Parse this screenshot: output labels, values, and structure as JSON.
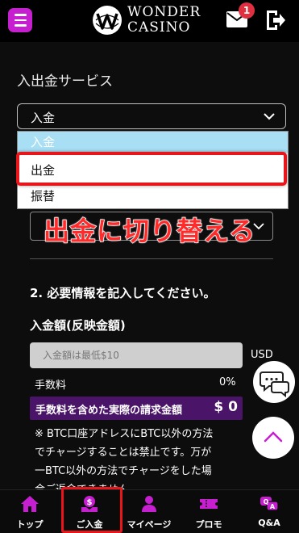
{
  "header": {
    "logo_line1": "WONDER",
    "logo_line2": "CASINO",
    "mail_badge": "1"
  },
  "page": {
    "section_title": "入出金サービス",
    "select_value": "入金"
  },
  "dropdown": {
    "options": [
      "入金",
      "出金",
      "振替"
    ],
    "highlighted_index": 1
  },
  "annotation": "出金に切り替える",
  "form": {
    "step2": "2. 必要情報を記入してください。",
    "amount_label": "入金額(反映金額)",
    "amount_placeholder": "入金額は最低$10",
    "currency": "USD",
    "fee_label": "手数料",
    "fee_value": "0%",
    "total_label": "手数料を含めた実際の請求金額",
    "total_value": "$ 0",
    "notice_lines": [
      "※ BTC口座アドレスにBTC以外の方法",
      "でチャージすることは禁止です。万が",
      "一BTC以外の方法でチャージをした場",
      "合ご返金できません"
    ]
  },
  "bottom_nav": {
    "items": [
      {
        "label": "トップ",
        "icon": "home-icon"
      },
      {
        "label": "ご入金",
        "icon": "deposit-icon"
      },
      {
        "label": "マイページ",
        "icon": "user-icon"
      },
      {
        "label": "プロモ",
        "icon": "ticket-icon"
      },
      {
        "label": "Q&A",
        "icon": "qa-icon"
      }
    ]
  },
  "colors": {
    "accent": "#c61fd0",
    "total_bar": "#4a1568",
    "highlight_red": "#e8161b",
    "badge_red": "#e0303f",
    "dropdown_selected": "#a8dff4"
  }
}
